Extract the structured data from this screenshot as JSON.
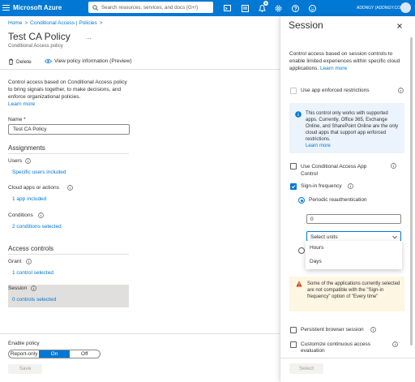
{
  "topbar": {
    "brand": "Microsoft Azure",
    "search_placeholder": "Search resources, services, and docs (G+/)",
    "notification_count": "1",
    "account": "ADDNGY (ADDNGY.COM)"
  },
  "breadcrumb": [
    "Home",
    "Conditional Access | Policies"
  ],
  "policy": {
    "title": "Test CA Policy",
    "subtitle": "Conditional Access policy",
    "more": "...",
    "commands": {
      "delete": "Delete",
      "view_info": "View policy information (Preview)"
    },
    "description": "Control access based on Conditional Access policy to bring signals together, to make decisions, and enforce organizational policies.",
    "learn_more": "Learn more",
    "name_label": "Name *",
    "name_value": "Test CA Policy",
    "assignments_heading": "Assignments",
    "users_label": "Users",
    "users_value": "Specific users included",
    "cloud_label": "Cloud apps or actions",
    "cloud_value": "1 app included",
    "conditions_label": "Conditions",
    "conditions_value": "2 conditions selected",
    "access_heading": "Access controls",
    "grant_label": "Grant",
    "grant_value": "1 control selected",
    "session_label": "Session",
    "session_value": "0 controls selected",
    "enable_label": "Enable policy",
    "toggle": [
      "Report-only",
      "On",
      "Off"
    ],
    "toggle_selected": "On",
    "save": "Save"
  },
  "panel": {
    "title": "Session",
    "description": "Control access based on session controls to enable limited experiences within specific cloud applications.",
    "learn_more": "Learn more",
    "app_enforced": {
      "label": "Use app enforced restrictions",
      "checked": false,
      "disabled": true
    },
    "info_text": "This control only works with supported apps. Currently, Office 365, Exchange Online, and SharePoint Online are the only cloud apps that support app enforced restrictions.",
    "info_learn_more": "Learn more",
    "ca_app_control": {
      "label": "Use Conditional Access App Control",
      "checked": false
    },
    "sign_in_frequency": {
      "label": "Sign-in frequency",
      "checked": true
    },
    "periodic_reauth": {
      "label": "Periodic reauthentication",
      "selected": true
    },
    "frequency_value": "0",
    "units_placeholder": "Select units",
    "units_options": [
      "Hours",
      "Days"
    ],
    "warning_text": "Some of the applications currently selected are not compatible with the \"Sign-in frequency\" option of \"Every time\"",
    "persistent_browser": {
      "label": "Persistent browser session",
      "checked": false
    },
    "continuous_eval": {
      "label": "Customize continuous access evaluation",
      "checked": false
    },
    "select": "Select"
  },
  "colors": {
    "accent": "#0078d4",
    "warning": "#d83b01",
    "info_bg": "#ebf3fc",
    "warning_bg": "#fdf6e3"
  }
}
